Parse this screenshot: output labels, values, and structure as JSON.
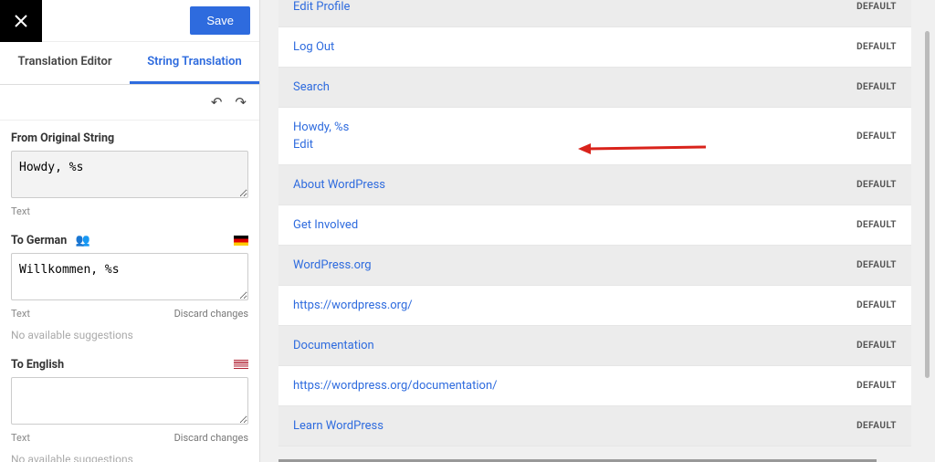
{
  "topbar": {
    "save": "Save"
  },
  "tabs": {
    "editor": "Translation Editor",
    "string": "String Translation"
  },
  "original": {
    "label": "From Original String",
    "value": "Howdy, %s",
    "hint": "Text"
  },
  "german": {
    "label": "To German",
    "value": "Willkommen, %s",
    "hint": "Text",
    "discard": "Discard changes",
    "no_suggest": "No available suggestions"
  },
  "english": {
    "label": "To English",
    "value": "",
    "hint": "Text",
    "discard": "Discard changes",
    "no_suggest": "No available suggestions"
  },
  "rows": [
    {
      "text": "Edit Profile",
      "badge": "DEFAULT",
      "cls": "odd"
    },
    {
      "text": "Log Out",
      "badge": "DEFAULT",
      "cls": "even"
    },
    {
      "text": "Search",
      "badge": "DEFAULT",
      "cls": "odd"
    },
    {
      "text": "Howdy, %s",
      "badge": "DEFAULT",
      "cls": "selected",
      "edit": "Edit"
    },
    {
      "text": "About WordPress",
      "badge": "DEFAULT",
      "cls": "odd"
    },
    {
      "text": "Get Involved",
      "badge": "DEFAULT",
      "cls": "even"
    },
    {
      "text": "WordPress.org",
      "badge": "DEFAULT",
      "cls": "odd"
    },
    {
      "text": "https://wordpress.org/",
      "badge": "DEFAULT",
      "cls": "even"
    },
    {
      "text": "Documentation",
      "badge": "DEFAULT",
      "cls": "odd"
    },
    {
      "text": "https://wordpress.org/documentation/",
      "badge": "DEFAULT",
      "cls": "even"
    },
    {
      "text": "Learn WordPress",
      "badge": "DEFAULT",
      "cls": "odd"
    }
  ]
}
